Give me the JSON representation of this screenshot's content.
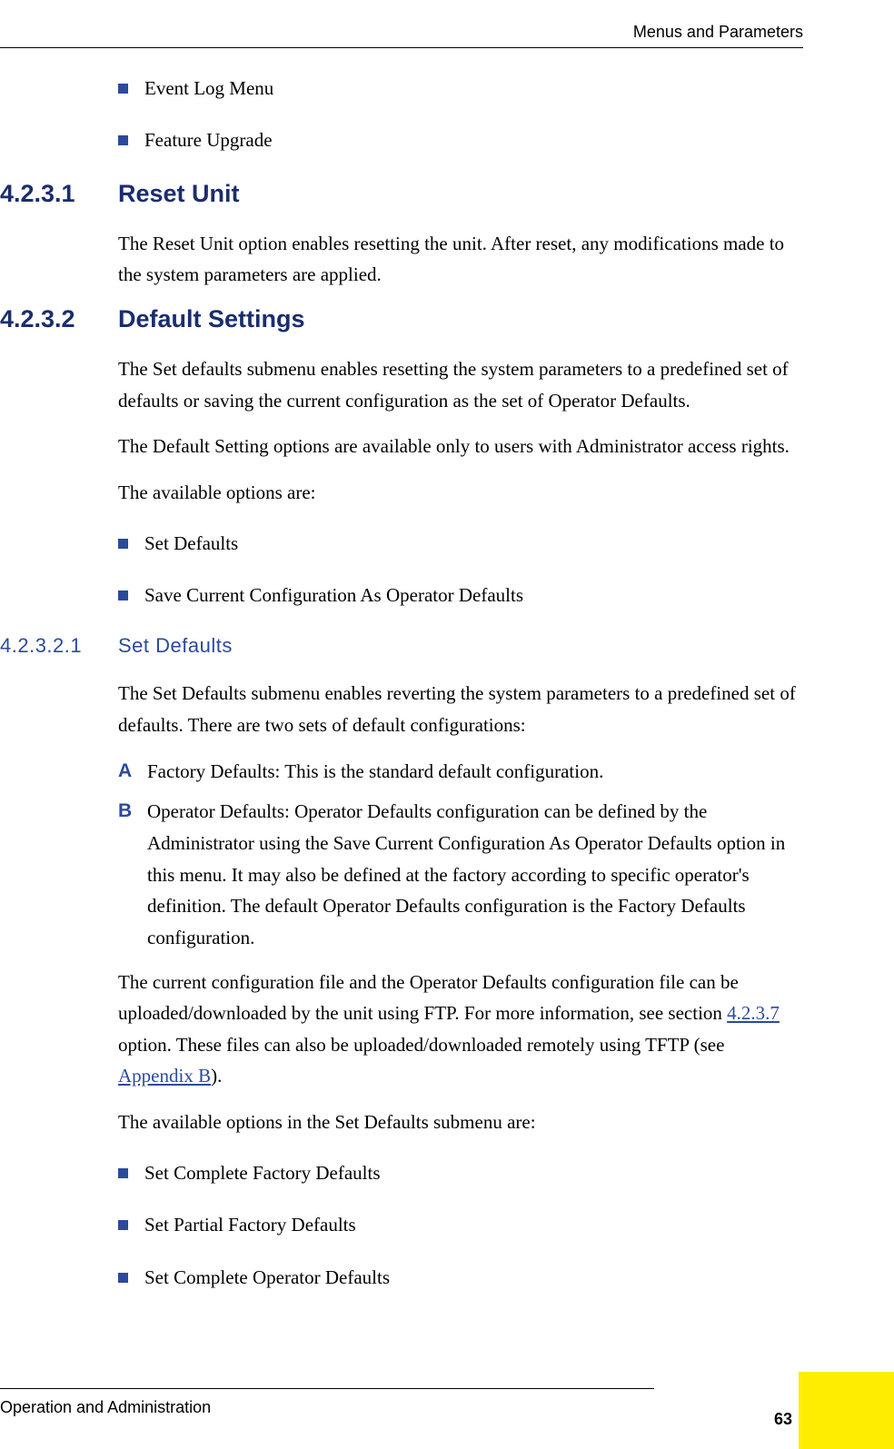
{
  "header": {
    "right": "Menus and Parameters"
  },
  "intro_bullets": [
    "Event Log Menu",
    "Feature Upgrade"
  ],
  "section1": {
    "num": "4.2.3.1",
    "title": "Reset Unit",
    "p1": "The Reset Unit option enables resetting the unit. After reset, any modifications made to the system parameters are applied."
  },
  "section2": {
    "num": "4.2.3.2",
    "title": "Default Settings",
    "p1": "The Set defaults submenu enables resetting the system parameters to a predefined set of defaults or saving the current configuration as the set of Operator Defaults.",
    "p2": "The Default Setting options are available only to users with Administrator access rights.",
    "p3": "The available options are:",
    "bullets": [
      "Set Defaults",
      "Save Current Configuration As Operator Defaults"
    ]
  },
  "subsection": {
    "num": "4.2.3.2.1",
    "title": "Set Defaults",
    "p1": "The Set Defaults submenu enables reverting the system parameters to a predefined set of defaults. There are two sets of default configurations:",
    "letters": [
      {
        "m": "A",
        "t": "Factory Defaults: This is the standard default configuration."
      },
      {
        "m": "B",
        "t": "Operator Defaults: Operator Defaults configuration can be defined by the Administrator using the Save Current Configuration As Operator Defaults option in this menu. It may also be defined at the factory according to specific operator's definition. The default Operator Defaults configuration is the Factory Defaults configuration."
      }
    ],
    "p2_pre": "The current configuration file and the Operator Defaults configuration file can be uploaded/downloaded by the unit using FTP. For more information, see section ",
    "link1": "4.2.3.7 ",
    "p2_mid": "option. These files can also be uploaded/downloaded remotely using TFTP (see ",
    "link2": "Appendix B",
    "p2_post": ").",
    "p3": "The available options in the Set Defaults submenu are:",
    "bullets": [
      "Set Complete Factory Defaults",
      "Set Partial Factory Defaults",
      "Set Complete Operator Defaults"
    ]
  },
  "footer": {
    "left": "Operation and Administration",
    "page": "63"
  }
}
